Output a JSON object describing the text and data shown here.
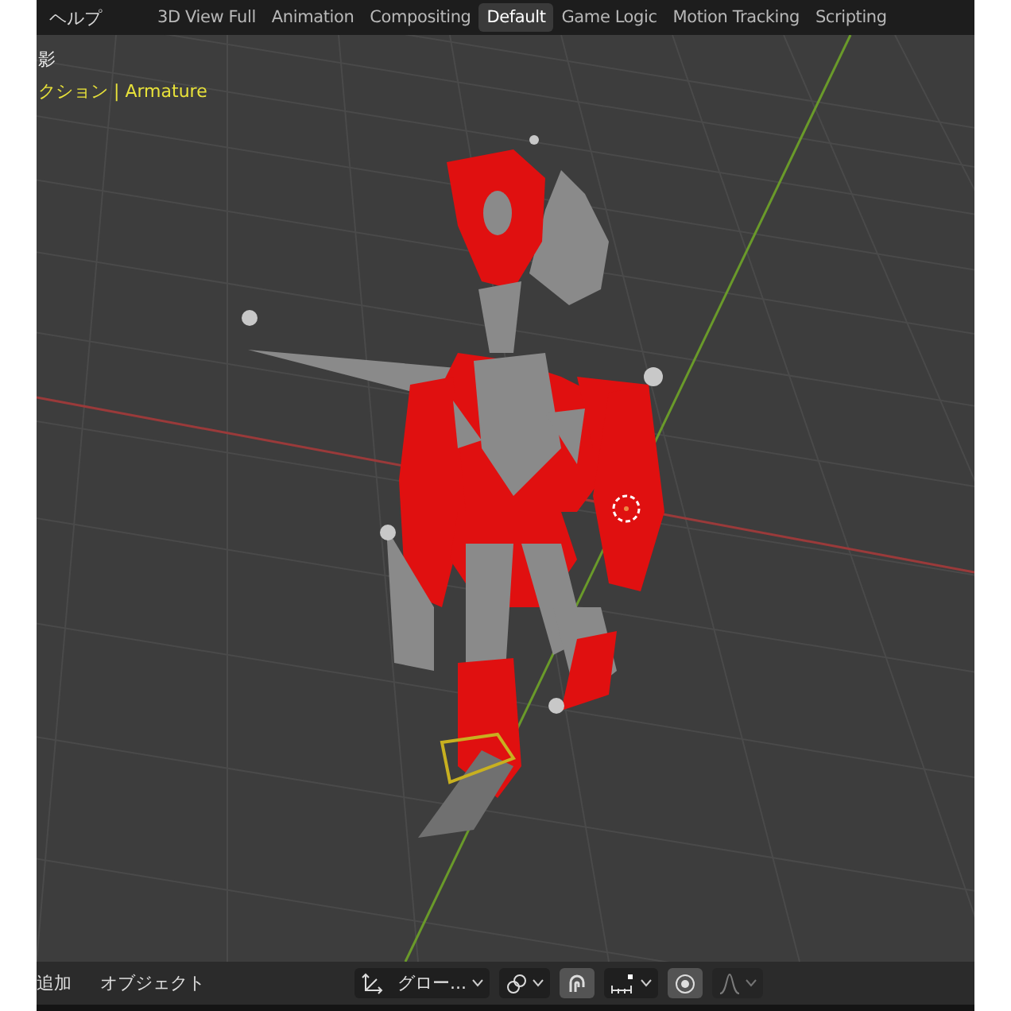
{
  "menu": [
    "ヘルプ"
  ],
  "tabs": [
    {
      "label": "3D View Full",
      "selected": false
    },
    {
      "label": "Animation",
      "selected": false
    },
    {
      "label": "Compositing",
      "selected": false
    },
    {
      "label": "Default",
      "selected": true
    },
    {
      "label": "Game Logic",
      "selected": false
    },
    {
      "label": "Motion Tracking",
      "selected": false
    },
    {
      "label": "Scripting",
      "selected": false
    }
  ],
  "viewport": {
    "view_name": "影",
    "collection_line": "クション | Armature"
  },
  "header": {
    "menus": [
      "追加",
      "オブジェクト"
    ],
    "tools": [
      {
        "kind": "dropdown",
        "label": "グロー..."
      },
      {
        "kind": "icon_dropdown",
        "disabled": false
      },
      {
        "kind": "toggle",
        "on": true
      },
      {
        "kind": "icon_dropdown",
        "disabled": false
      },
      {
        "kind": "toggle",
        "on": true
      },
      {
        "kind": "icon_dropdown",
        "disabled": true
      }
    ]
  }
}
